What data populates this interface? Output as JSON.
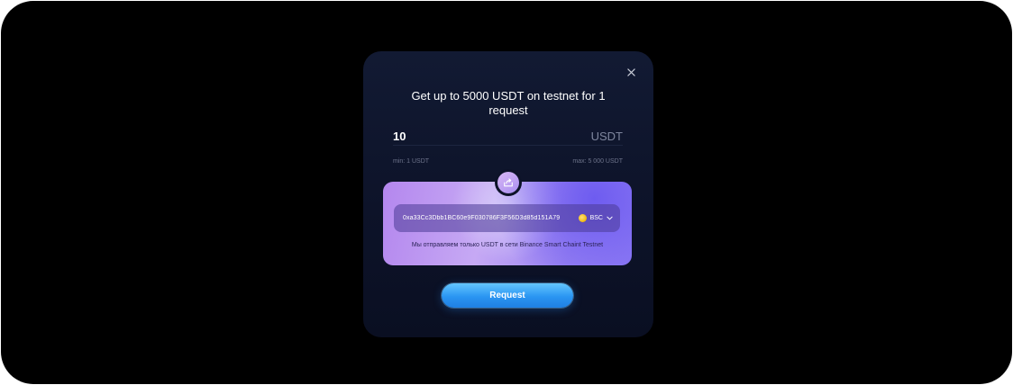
{
  "modal": {
    "title": "Get up to 5000 USDT on testnet for 1 request",
    "close_icon": "close-icon",
    "amount": {
      "value": "10",
      "currency": "USDT"
    },
    "limits": {
      "min": "min: 1 USDT",
      "max": "max: 5 000 USDT"
    },
    "share_icon": "share-icon",
    "card": {
      "address": "0xa33Cc3Dbb1BC60e9F030786F3F56D3d85d151A79",
      "network": "BSC",
      "network_icon": "bnb-coin-icon",
      "note": "Мы отправляем только USDT в сети Binance Smart Chaint Testnet"
    },
    "request_label": "Request"
  },
  "colors": {
    "modal_bg": "#0d1329",
    "accent_button": "#2a95f2",
    "card_gradient_start": "#b487ee",
    "card_gradient_end": "#8f7cf5",
    "coin": "#f0b90b"
  }
}
